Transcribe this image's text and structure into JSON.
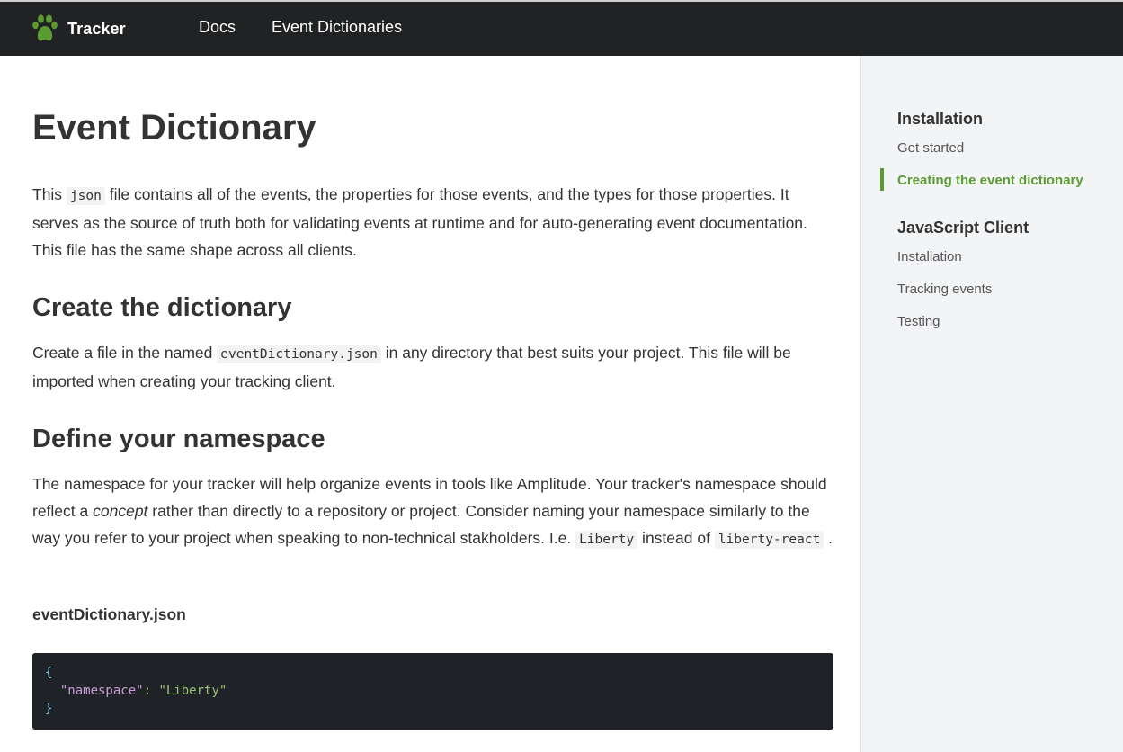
{
  "header": {
    "brand": "Tracker",
    "nav": [
      "Docs",
      "Event Dictionaries"
    ],
    "logo_icon": "paw-icon",
    "logo_color": "#5c9a33"
  },
  "main": {
    "title": "Event Dictionary",
    "intro": {
      "before": "This ",
      "code": "json",
      "after": " file contains all of the events, the properties for those events, and the types for those properties. It serves as the source of truth both for validating events at runtime and for auto-generating event documentation. This file has the same shape across all clients."
    },
    "create": {
      "heading": "Create the dictionary",
      "before": "Create a file in the named ",
      "code": "eventDictionary.json",
      "after": " in any directory that best suits your project. This file will be imported when creating your tracking client."
    },
    "define": {
      "heading": "Define your namespace",
      "text1": "The namespace for your tracker will help organize events in tools like Amplitude. Your tracker's namespace should reflect a ",
      "emphasis": "concept",
      "text2": " rather than directly to a repository or project. Consider naming your namespace similarly to the way you refer to your project when speaking to non-technical stakholders. I.e. ",
      "code1": "Liberty",
      "text3": " instead of ",
      "code2": "liberty-react",
      "text4": " ."
    },
    "file_label": "eventDictionary.json",
    "code": {
      "open": "{",
      "key": "\"namespace\"",
      "colon": ":",
      "value": "\"Liberty\"",
      "close": "}"
    }
  },
  "sidebar": {
    "sections": [
      {
        "heading": "Installation",
        "items": [
          "Get started",
          "Creating the event dictionary"
        ]
      },
      {
        "heading": "JavaScript Client",
        "items": [
          "Installation",
          "Tracking events",
          "Testing"
        ]
      }
    ],
    "active_item": "Creating the event dictionary",
    "accent_color": "#5c9a33"
  }
}
